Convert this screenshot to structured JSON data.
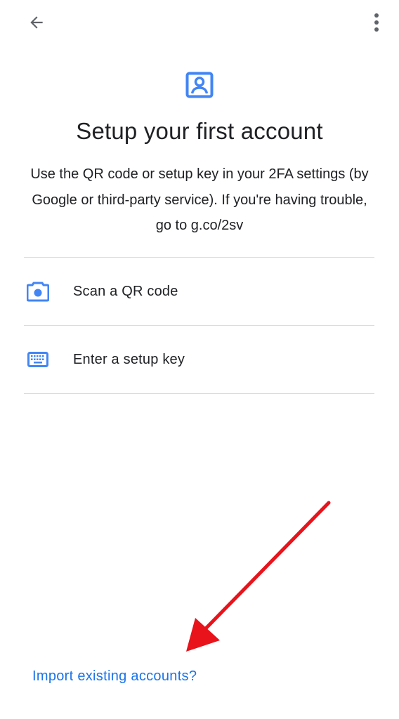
{
  "header": {
    "back_icon": "arrow-back-icon",
    "overflow_icon": "more-vert-icon"
  },
  "hero": {
    "icon": "account-box-icon",
    "title": "Setup your first account",
    "description": "Use the QR code or setup key in your 2FA settings (by Google or third-party service). If you're having trouble, go to g.co/2sv"
  },
  "options": [
    {
      "icon": "camera-icon",
      "label": "Scan a QR code"
    },
    {
      "icon": "keyboard-icon",
      "label": "Enter a setup key"
    }
  ],
  "footer": {
    "import_label": "Import existing accounts?"
  },
  "annotation": {
    "arrow": "red-arrow-pointing-to-import-link"
  },
  "colors": {
    "accent": "#1a73e8",
    "icon_blue": "#4285f4",
    "text": "#202124",
    "divider": "#dadce0",
    "annotation_red": "#e8131b"
  }
}
